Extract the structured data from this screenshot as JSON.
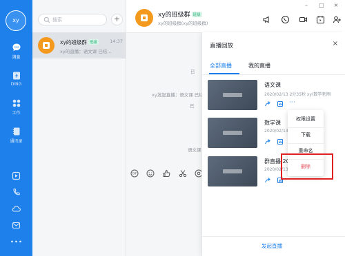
{
  "rail": {
    "avatar_text": "xy",
    "items": [
      {
        "label": "消息",
        "icon": "chat-bubble-icon"
      },
      {
        "label": "DING",
        "icon": "ding-icon"
      },
      {
        "label": "工作",
        "icon": "apps-grid-icon"
      },
      {
        "label": "通讯录",
        "icon": "contacts-icon"
      }
    ]
  },
  "sidebar": {
    "search_placeholder": "搜索",
    "add_label": "+",
    "conversation": {
      "name": "xy的班级群",
      "tag": "班级",
      "time": "14:37",
      "preview": "xy的直播：语文课 已结..."
    }
  },
  "chat": {
    "title": "xy的班级群",
    "tag": "班级",
    "subtitle": "xy的班级群(xy的班级群)",
    "system_message": "xy发起直播：语文课 已结",
    "fragment_1": "语文课",
    "fragment_2": "已"
  },
  "panel": {
    "title": "直播回放",
    "close": "×",
    "tabs": [
      "全部直播",
      "我的直播"
    ],
    "videos": [
      {
        "title": "语文课",
        "meta": "2020/02/13 2分35秒 xy(数学老师)"
      },
      {
        "title": "数学课",
        "meta": "2020/02/13"
      },
      {
        "title": "群直播 20",
        "meta": "2020/02/13"
      }
    ],
    "more": "···",
    "menu": [
      "权限设置",
      "下载",
      "重命名",
      "删除"
    ],
    "footer_button": "发起直播"
  },
  "window": {
    "minimize": "–",
    "maximize": "□",
    "close": "×"
  },
  "colors": {
    "brand_blue": "#1e80ea",
    "group_orange": "#f39a1e",
    "danger_red": "#e34d59",
    "highlight_red": "#e02020"
  }
}
